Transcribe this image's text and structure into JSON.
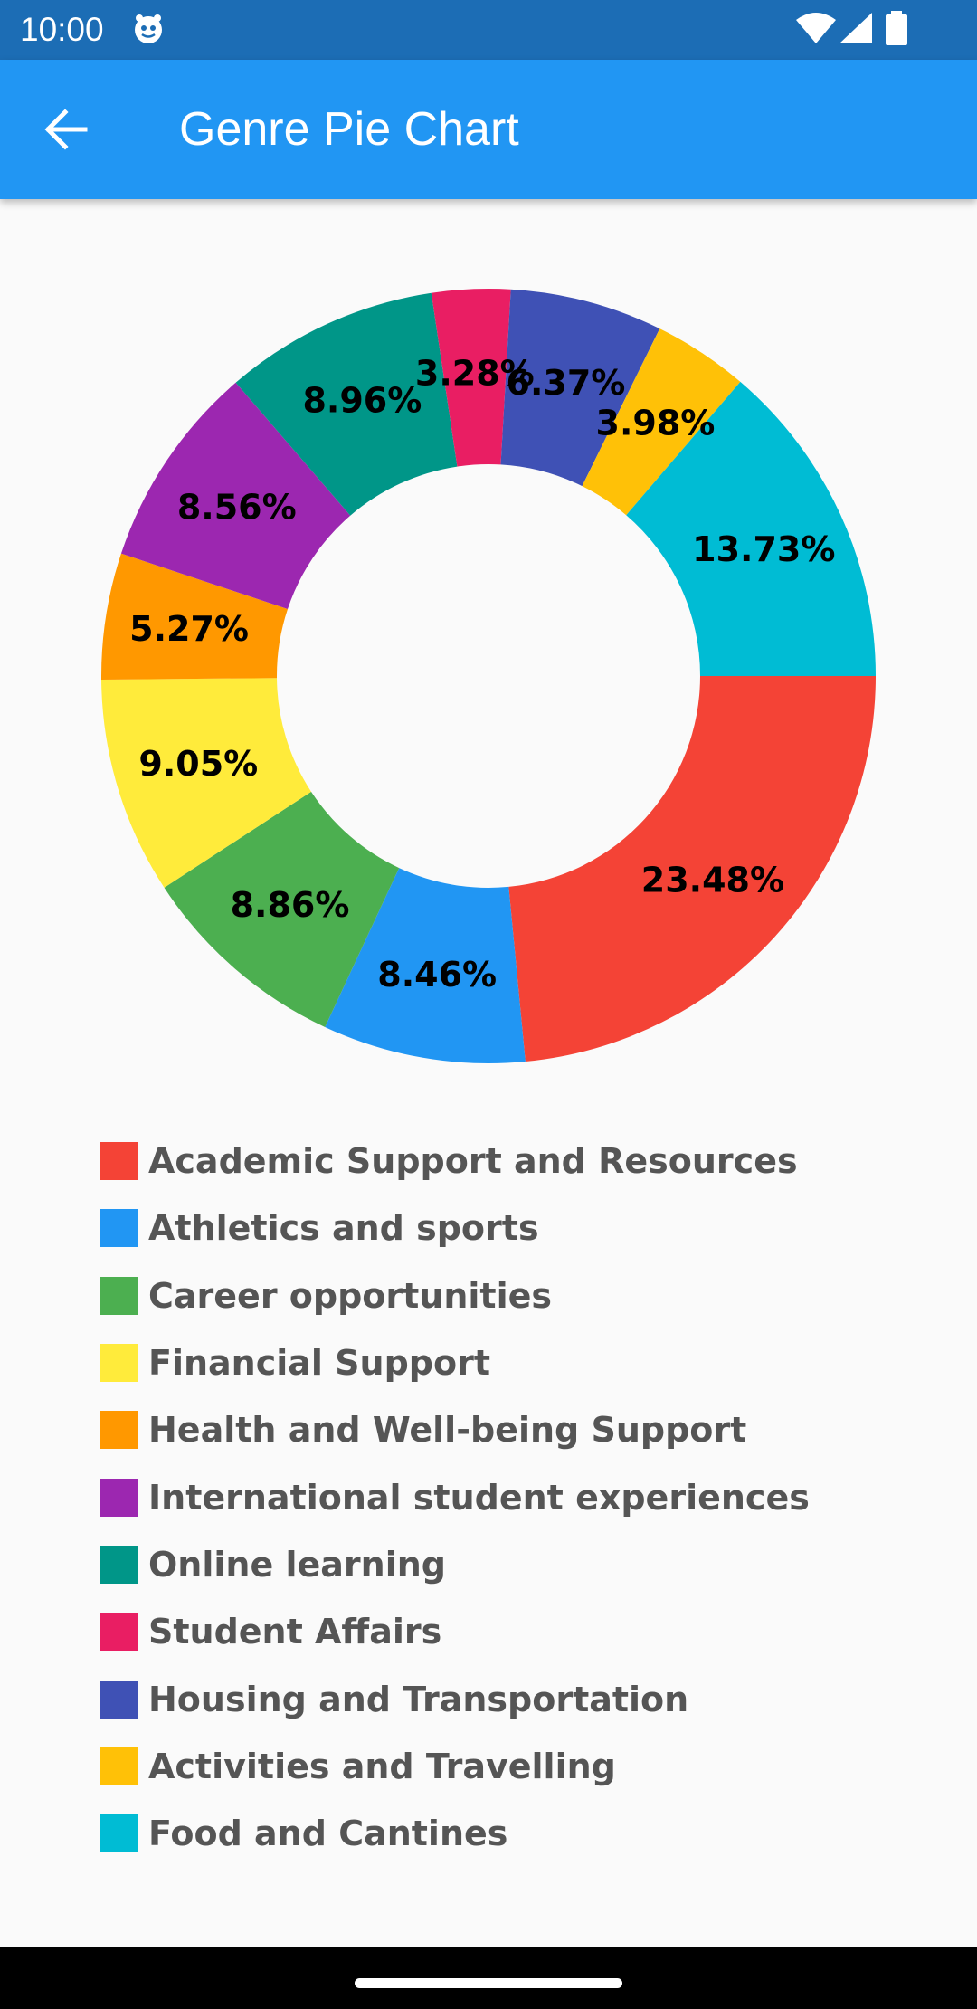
{
  "status_bar": {
    "time": "10:00",
    "icons": [
      "app-notification-icon",
      "wifi-icon",
      "cellular-signal-icon",
      "battery-icon"
    ]
  },
  "app_bar": {
    "title": "Genre Pie Chart",
    "back_icon": "arrow-back-icon",
    "color": "#2196f3"
  },
  "chart_data": {
    "type": "pie",
    "style": "donut",
    "title": "",
    "categories": [
      "Academic Support and Resources",
      "Athletics and sports",
      "Career opportunities",
      "Financial Support",
      "Health and Well-being Support",
      "International student experiences",
      "Online learning",
      "Student Affairs",
      "Housing and Transportation",
      "Activities and Travelling",
      "Food and Cantines"
    ],
    "values": [
      23.48,
      8.46,
      8.86,
      9.05,
      5.27,
      8.56,
      8.96,
      3.28,
      6.37,
      3.98,
      13.73
    ],
    "labels": [
      "23.48%",
      "8.46%",
      "8.86%",
      "9.05%",
      "5.27%",
      "8.56%",
      "8.96%",
      "3.28%",
      "6.37%",
      "3.98%",
      "13.73%"
    ],
    "colors": [
      "#f44336",
      "#2196f3",
      "#4caf50",
      "#ffeb3b",
      "#ff9800",
      "#9c27b0",
      "#009688",
      "#e91e63",
      "#3f51b5",
      "#ffc107",
      "#00bcd4"
    ],
    "start_angle_deg": 0,
    "direction": "clockwise",
    "legend_position": "bottom"
  }
}
